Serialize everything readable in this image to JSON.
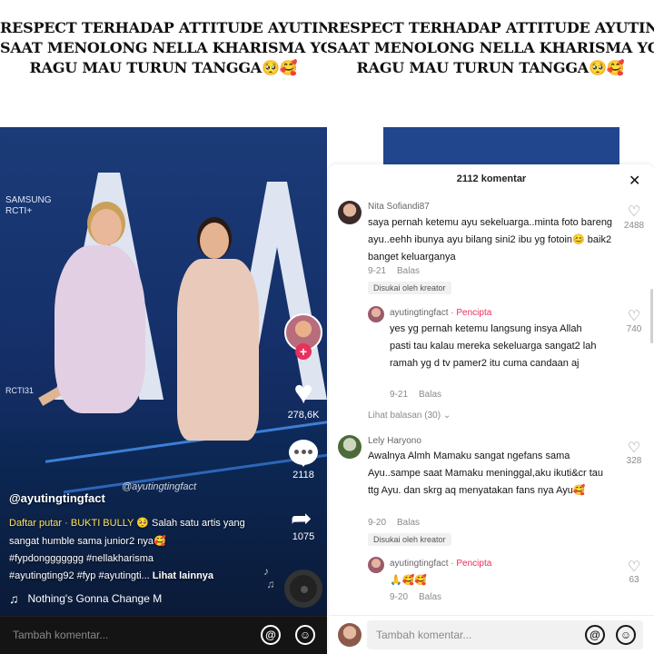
{
  "headline": {
    "line1": "RESPECT TERHADAP ATTITUDE AYUTINGTING",
    "line2": "SAAT MENOLONG NELLA KHARISMA YG",
    "line3": "RAGU MAU TURUN TANGGA",
    "emoji": "🥺🥰"
  },
  "video": {
    "screen_text": "SAMSUNG",
    "screen_text2": "RCTI+",
    "screen_text3": "RCTI31",
    "watermark": "@ayutingtingfact",
    "likes": "278,6K",
    "comments": "2118",
    "shares": "1075",
    "username": "@ayutingtingfact",
    "playlist_label": "Daftar putar · BUKTI BULLY",
    "caption_rest": "Salah satu artis yang sangat humble sama junior2 nya",
    "hashtags_line1": "#fypdonggggggg #nellakharisma",
    "hashtags_line2": "#ayutingting92 #fyp #ayutingti...",
    "more_label": "Lihat lainnya",
    "music": "Nothing's Gonna Change M",
    "comment_placeholder": "Tambah komentar...",
    "at_label": "@",
    "emoji_label": "☺"
  },
  "sheet": {
    "title": "2112 komentar",
    "close": "✕",
    "comments": [
      {
        "user": "Nita Sofiandi87",
        "text": "saya pernah ketemu ayu sekeluarga..minta foto bareng ayu..eehh ibunya ayu bilang sini2 ibu yg fotoin😊 baik2 banget keluarganya",
        "date": "9-21",
        "reply": "Balas",
        "liked": "Disukai oleh kreator",
        "likes": "2488"
      },
      {
        "user": "ayutingtingfact",
        "creator_tag": "· Pencipta",
        "text": "yes yg pernah ketemu langsung insya Allah pasti tau kalau mereka sekeluarga sangat2 lah ramah yg d tv pamer2 itu cuma candaan aj",
        "date": "9-21",
        "reply": "Balas",
        "likes": "740"
      },
      {
        "replies_link": "Lihat balasan (30) ⌄"
      },
      {
        "user": "Lely Haryono",
        "text": "Awalnya Almh Mamaku sangat ngefans sama Ayu..sampe saat Mamaku meninggal,aku ikuti&cr tau ttg Ayu. dan skrg aq menyatakan fans nya Ayu🥰",
        "date": "9-20",
        "reply": "Balas",
        "liked": "Disukai oleh kreator",
        "likes": "328"
      },
      {
        "user": "ayutingtingfact",
        "creator_tag": "· Pencipta",
        "text": "🙏🥰🥰",
        "date": "9-20",
        "reply": "Balas",
        "likes": "63"
      }
    ],
    "comment_placeholder": "Tambah komentar...",
    "at_label": "@",
    "emoji_label": "☺"
  },
  "colors": {
    "accent": "#ea2f5a",
    "playlist": "#ffe15a",
    "video_bg": "#15306a"
  }
}
